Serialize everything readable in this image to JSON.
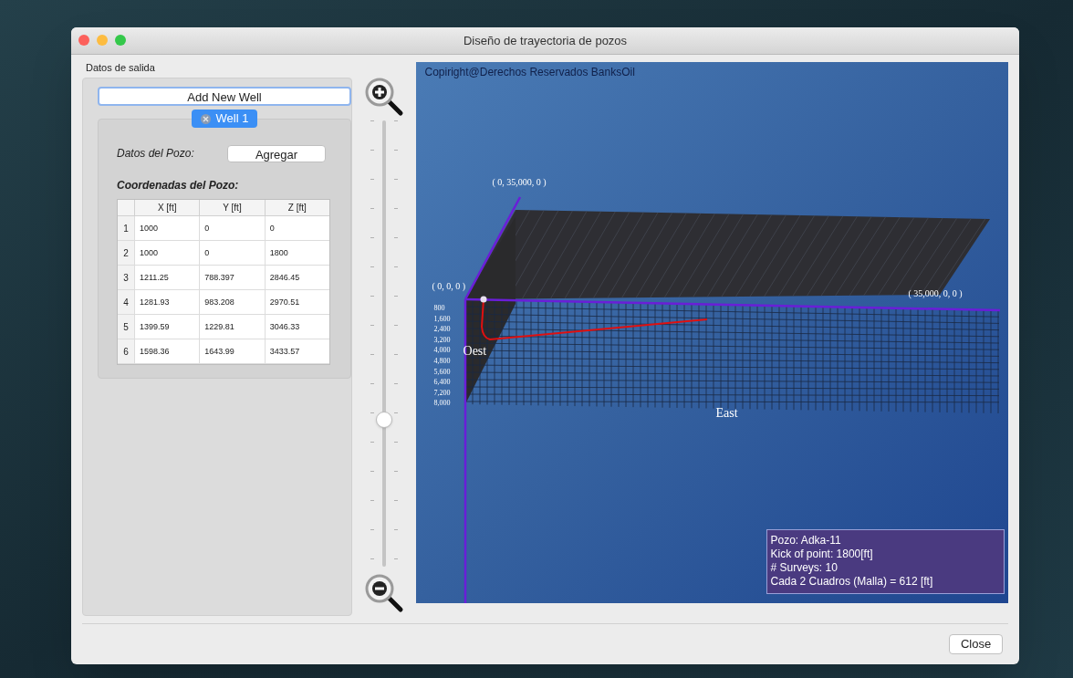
{
  "window": {
    "title": "Diseño de trayectoria de pozos"
  },
  "output_panel": {
    "title": "Datos de salida"
  },
  "add_well_button": "Add New Well",
  "well_tabs": [
    {
      "label": "Well 1",
      "selected": true
    }
  ],
  "well_data_label": "Datos del Pozo:",
  "add_button": "Agregar",
  "coords_title": "Coordenadas del Pozo:",
  "table": {
    "columns": [
      "X [ft]",
      "Y [ft]",
      "Z [ft]"
    ],
    "rows": [
      {
        "index": "1",
        "cells": [
          "1000",
          "0",
          "0"
        ]
      },
      {
        "index": "2",
        "cells": [
          "1000",
          "0",
          "1800"
        ]
      },
      {
        "index": "3",
        "cells": [
          "1211.25",
          "788.397",
          "2846.45"
        ]
      },
      {
        "index": "4",
        "cells": [
          "1281.93",
          "983.208",
          "2970.51"
        ]
      },
      {
        "index": "5",
        "cells": [
          "1399.59",
          "1229.81",
          "3046.33"
        ]
      },
      {
        "index": "6",
        "cells": [
          "1598.36",
          "1643.99",
          "3433.57"
        ]
      }
    ]
  },
  "zoom_slider": {
    "level": 0.33
  },
  "scene": {
    "copyright": "Copiright@Derechos Reservados BanksOil",
    "axis_labels": [
      "( 0, 35,000, 0 )",
      "( 0, 0, 0 )",
      "( 35,000, 0, 0 )"
    ],
    "depth_labels": [
      "800",
      "1,600",
      "2,400",
      "3,200",
      "4,000",
      "4,800",
      "5,600",
      "6,400",
      "7,200",
      "8,000"
    ],
    "west_label": "Oest",
    "east_label": "East",
    "info": [
      "Pozo: Adka-11",
      "Kick of point: 1800[ft]",
      "# Surveys: 10",
      "Cada 2 Cuadros (Malla) = 612 [ft]"
    ]
  },
  "close_button": "Close"
}
